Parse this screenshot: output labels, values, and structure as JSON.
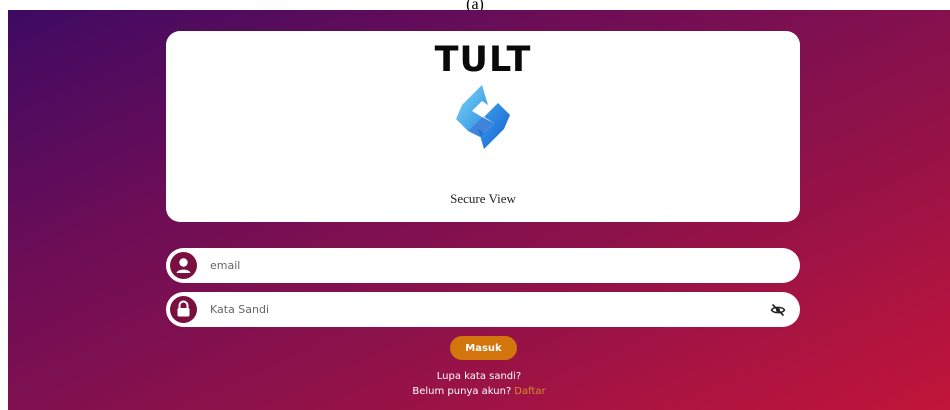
{
  "figure_caption": "(a)",
  "brand": {
    "title": "TULT",
    "subtitle": "Secure View",
    "logo_icon": "secure-view-logo-icon"
  },
  "form": {
    "email": {
      "placeholder": "email",
      "value": "",
      "icon": "user-icon"
    },
    "password": {
      "placeholder": "Kata Sandi",
      "value": "",
      "icon": "lock-icon",
      "toggle_icon": "eye-slash-icon"
    },
    "submit_label": "Masuk"
  },
  "footer": {
    "forgot_label": "Lupa kata sandi?",
    "no_account_label": "Belum punya akun?",
    "signup_label": "Daftar"
  },
  "colors": {
    "gradient_start": "#3e0a63",
    "gradient_end": "#c2153a",
    "icon_badge": "#7a1040",
    "button": "#d2750d",
    "signup_link": "#d98a2b"
  }
}
